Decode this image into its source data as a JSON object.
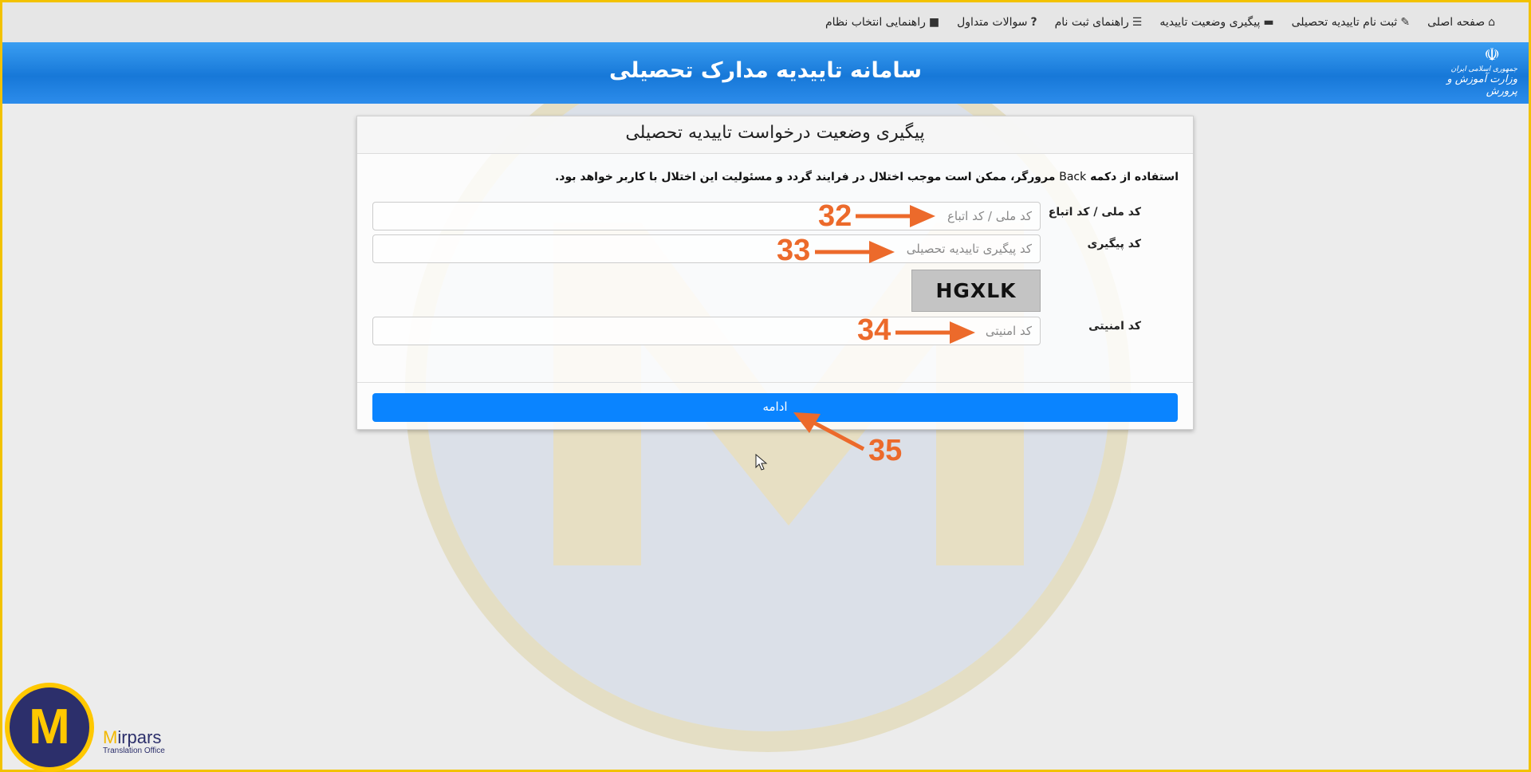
{
  "nav": {
    "items": [
      {
        "label": "صفحه اصلی",
        "icon": "home-icon"
      },
      {
        "label": "ثبت نام تاییدیه تحصیلی",
        "icon": "edit-icon"
      },
      {
        "label": "پیگیری وضعیت تاییدیه",
        "icon": "card-icon"
      },
      {
        "label": "راهنمای ثبت نام",
        "icon": "list-icon"
      },
      {
        "label": "سوالات متداول",
        "icon": "question-icon"
      },
      {
        "label": "راهنمایی انتخاب نظام",
        "icon": "book-icon"
      }
    ]
  },
  "banner": {
    "title": "سامانه تاییدیه مدارک تحصیلی",
    "emblem_line1": "جمهوری اسلامی ایران",
    "emblem_line2": "وزارت آموزش و پرورش"
  },
  "card": {
    "header": "پیگیری وضعیت درخواست تاییدیه تحصیلی",
    "notice_pre": "استفاده از دکمه",
    "notice_back": "Back",
    "notice_post": "مرورگر، ممکن است موجب اختلال در فرایند گردد و مسئولیت این اختلال با کاربر خواهد بود.",
    "fields": {
      "national_label": "کد ملی / کد اتباع",
      "national_placeholder": "کد ملی / کد اتباع",
      "tracking_label": "کد پیگیری",
      "tracking_placeholder": "کد پیگیری تاییدیه تحصیلی",
      "captcha_text": "HGXLK",
      "security_label": "کد امنیتی",
      "security_placeholder": "کد امنیتی"
    },
    "continue_label": "ادامه"
  },
  "annotations": [
    "32",
    "33",
    "34",
    "35"
  ],
  "annotation_color": "#ec6a2b",
  "watermark": {
    "brand_pre": "M",
    "brand_rest": "irpars",
    "tagline": "Translation Office"
  }
}
